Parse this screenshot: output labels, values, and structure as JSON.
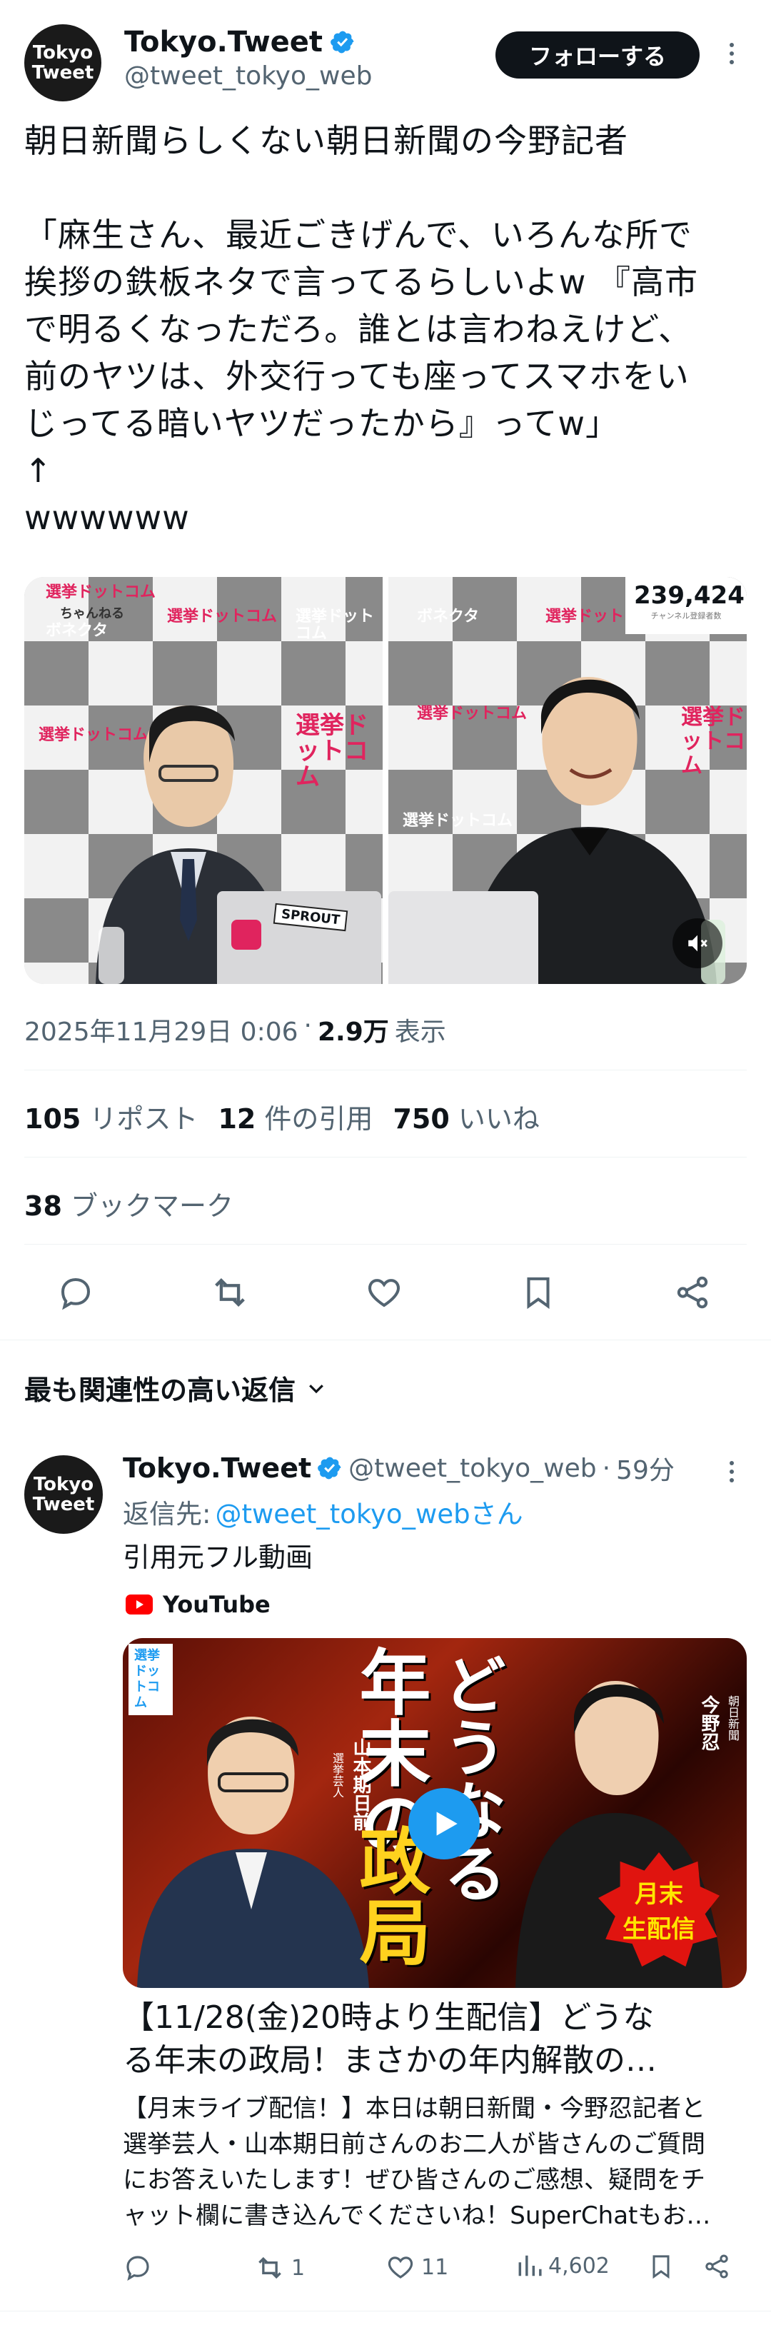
{
  "tweet": {
    "author_name": "Tokyo.Tweet",
    "author_handle": "@tweet_tokyo_web",
    "avatar_text_1": "Tokyo",
    "avatar_text_2": "Tweet",
    "follow_label": "フォローする",
    "text": "朝日新聞らしくない朝日新聞の今野記者\n\n「麻生さん、最近ごきげんで、いろんな所で\n挨拶の鉄板ネタで言ってるらしいよw 『高市\nで明るくなっただろ。誰とは言わねえけど、\n前のヤツは、外交行っても座ってスマホをい\nじってる暗いヤツだったから』ってw」\n↑\nwwwwww",
    "media": {
      "views_count": "239,424",
      "views_caption": "チャンネル登録者数",
      "logo_text": "選挙ドットコム",
      "logo_sub": "ちゃんねる",
      "bonekuta": "ボネクタ",
      "laptop_sticker": "SPROUT"
    },
    "timestamp": "2025年11月29日 0:06",
    "separator": "·",
    "views_value": "2.9万",
    "views_label": "表示",
    "reposts_count": "105",
    "reposts_label": "リポスト",
    "quotes_count": "12",
    "quotes_label": "件の引用",
    "likes_count": "750",
    "likes_label": "いいね",
    "bookmarks_count": "38",
    "bookmarks_label": "ブックマーク"
  },
  "replies_section": {
    "sort_label": "最も関連性の高い返信"
  },
  "reply": {
    "author_name": "Tokyo.Tweet",
    "author_handle": "@tweet_tokyo_web",
    "dot": "·",
    "time": "59分",
    "replying_to_label": "返信先:",
    "replying_to_handle": "@tweet_tokyo_webさん",
    "text": "引用元フル動画",
    "source_label": "YouTube",
    "card": {
      "thumb_big_1": "年末の",
      "thumb_big_2": "政局",
      "thumb_big_3": "どうなる",
      "left_name": "山本期日前",
      "left_role": "選挙芸人",
      "right_name": "今野忍",
      "right_role": "朝日新聞",
      "stamp_1": "月末",
      "stamp_2": "生配信",
      "corner_logo": "選挙ドットコム",
      "title": "【11/28(金)20時より生配信】どうな\nる年末の政局！まさかの年内解散の…",
      "description": "【月末ライブ配信！】本日は朝日新聞・今野忍記者と\n選挙芸人・山本期日前さんのお二人が皆さんのご質問\nにお答えいたします！ぜひ皆さんのご感想、疑問をチ\nャット欄に書き込んでくださいね！SuperChatもお…"
    },
    "retweets": "1",
    "likes": "11",
    "views": "4,602"
  },
  "colors": {
    "accent": "#1d9bf0",
    "text": "#0f1419",
    "muted": "#536471",
    "divider": "#eff3f4",
    "youtube_red": "#ff0000"
  }
}
